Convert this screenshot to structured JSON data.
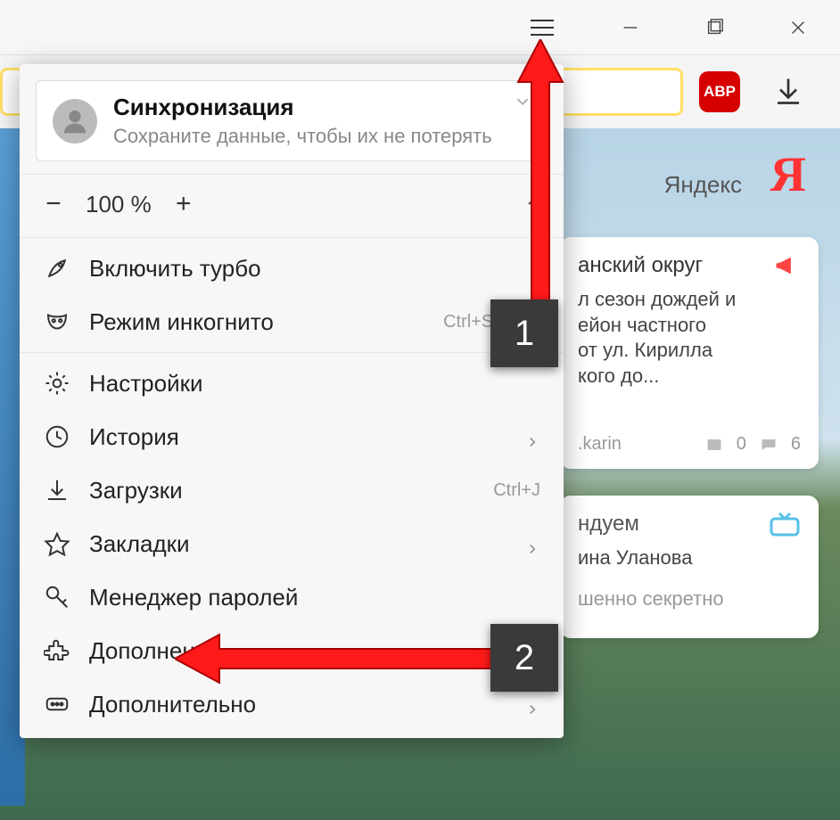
{
  "window_controls": {
    "minimize": "min",
    "maximize": "max",
    "close": "close"
  },
  "toolbar": {
    "abp_label": "ABP"
  },
  "page": {
    "yandex_text": "Яндекс",
    "yandex_logo": "Я"
  },
  "news_card": {
    "title": "анский округ",
    "body_lines": [
      "л сезон дождей и",
      "ейон частного",
      "от ул. Кирилла",
      "кого до..."
    ],
    "author": ".karin",
    "img_count": "0",
    "comment_count": "6"
  },
  "rec_card": {
    "head": "ндуем",
    "line1": "ина Уланова",
    "line2": "шенно секретно"
  },
  "menu": {
    "sync": {
      "title": "Синхронизация",
      "subtitle": "Сохраните данные, чтобы их не потерять"
    },
    "zoom": {
      "minus": "−",
      "value": "100 %",
      "plus": "+"
    },
    "items": {
      "turbo": "Включить турбо",
      "incognito": "Режим инкогнито",
      "incognito_shortcut": "Ctrl+Shift+N",
      "settings": "Настройки",
      "history": "История",
      "downloads": "Загрузки",
      "downloads_shortcut": "Ctrl+J",
      "bookmarks": "Закладки",
      "passwords": "Менеджер паролей",
      "extensions": "Дополнения",
      "more": "Дополнительно"
    }
  },
  "annotations": {
    "step1": "1",
    "step2": "2"
  }
}
